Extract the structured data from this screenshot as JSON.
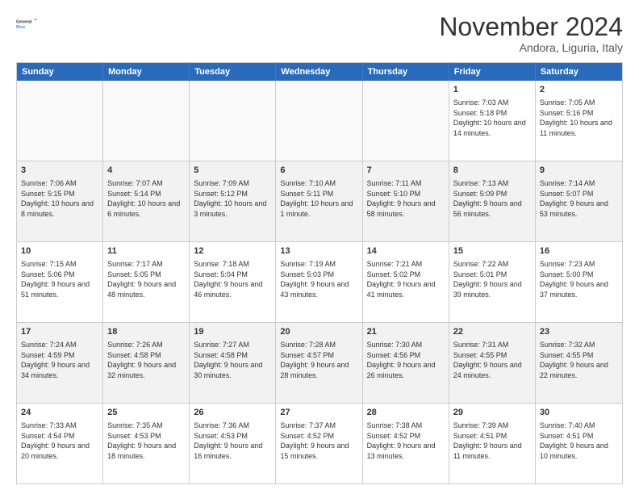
{
  "header": {
    "logo": {
      "line1": "General",
      "line2": "Blue"
    },
    "title": "November 2024",
    "location": "Andora, Liguria, Italy"
  },
  "days_of_week": [
    "Sunday",
    "Monday",
    "Tuesday",
    "Wednesday",
    "Thursday",
    "Friday",
    "Saturday"
  ],
  "weeks": [
    [
      {
        "day": "",
        "info": "",
        "empty": true
      },
      {
        "day": "",
        "info": "",
        "empty": true
      },
      {
        "day": "",
        "info": "",
        "empty": true
      },
      {
        "day": "",
        "info": "",
        "empty": true
      },
      {
        "day": "",
        "info": "",
        "empty": true
      },
      {
        "day": "1",
        "info": "Sunrise: 7:03 AM\nSunset: 5:18 PM\nDaylight: 10 hours and 14 minutes.",
        "empty": false
      },
      {
        "day": "2",
        "info": "Sunrise: 7:05 AM\nSunset: 5:16 PM\nDaylight: 10 hours and 11 minutes.",
        "empty": false
      }
    ],
    [
      {
        "day": "3",
        "info": "Sunrise: 7:06 AM\nSunset: 5:15 PM\nDaylight: 10 hours and 8 minutes.",
        "empty": false
      },
      {
        "day": "4",
        "info": "Sunrise: 7:07 AM\nSunset: 5:14 PM\nDaylight: 10 hours and 6 minutes.",
        "empty": false
      },
      {
        "day": "5",
        "info": "Sunrise: 7:09 AM\nSunset: 5:12 PM\nDaylight: 10 hours and 3 minutes.",
        "empty": false
      },
      {
        "day": "6",
        "info": "Sunrise: 7:10 AM\nSunset: 5:11 PM\nDaylight: 10 hours and 1 minute.",
        "empty": false
      },
      {
        "day": "7",
        "info": "Sunrise: 7:11 AM\nSunset: 5:10 PM\nDaylight: 9 hours and 58 minutes.",
        "empty": false
      },
      {
        "day": "8",
        "info": "Sunrise: 7:13 AM\nSunset: 5:09 PM\nDaylight: 9 hours and 56 minutes.",
        "empty": false
      },
      {
        "day": "9",
        "info": "Sunrise: 7:14 AM\nSunset: 5:07 PM\nDaylight: 9 hours and 53 minutes.",
        "empty": false
      }
    ],
    [
      {
        "day": "10",
        "info": "Sunrise: 7:15 AM\nSunset: 5:06 PM\nDaylight: 9 hours and 51 minutes.",
        "empty": false
      },
      {
        "day": "11",
        "info": "Sunrise: 7:17 AM\nSunset: 5:05 PM\nDaylight: 9 hours and 48 minutes.",
        "empty": false
      },
      {
        "day": "12",
        "info": "Sunrise: 7:18 AM\nSunset: 5:04 PM\nDaylight: 9 hours and 46 minutes.",
        "empty": false
      },
      {
        "day": "13",
        "info": "Sunrise: 7:19 AM\nSunset: 5:03 PM\nDaylight: 9 hours and 43 minutes.",
        "empty": false
      },
      {
        "day": "14",
        "info": "Sunrise: 7:21 AM\nSunset: 5:02 PM\nDaylight: 9 hours and 41 minutes.",
        "empty": false
      },
      {
        "day": "15",
        "info": "Sunrise: 7:22 AM\nSunset: 5:01 PM\nDaylight: 9 hours and 39 minutes.",
        "empty": false
      },
      {
        "day": "16",
        "info": "Sunrise: 7:23 AM\nSunset: 5:00 PM\nDaylight: 9 hours and 37 minutes.",
        "empty": false
      }
    ],
    [
      {
        "day": "17",
        "info": "Sunrise: 7:24 AM\nSunset: 4:59 PM\nDaylight: 9 hours and 34 minutes.",
        "empty": false
      },
      {
        "day": "18",
        "info": "Sunrise: 7:26 AM\nSunset: 4:58 PM\nDaylight: 9 hours and 32 minutes.",
        "empty": false
      },
      {
        "day": "19",
        "info": "Sunrise: 7:27 AM\nSunset: 4:58 PM\nDaylight: 9 hours and 30 minutes.",
        "empty": false
      },
      {
        "day": "20",
        "info": "Sunrise: 7:28 AM\nSunset: 4:57 PM\nDaylight: 9 hours and 28 minutes.",
        "empty": false
      },
      {
        "day": "21",
        "info": "Sunrise: 7:30 AM\nSunset: 4:56 PM\nDaylight: 9 hours and 26 minutes.",
        "empty": false
      },
      {
        "day": "22",
        "info": "Sunrise: 7:31 AM\nSunset: 4:55 PM\nDaylight: 9 hours and 24 minutes.",
        "empty": false
      },
      {
        "day": "23",
        "info": "Sunrise: 7:32 AM\nSunset: 4:55 PM\nDaylight: 9 hours and 22 minutes.",
        "empty": false
      }
    ],
    [
      {
        "day": "24",
        "info": "Sunrise: 7:33 AM\nSunset: 4:54 PM\nDaylight: 9 hours and 20 minutes.",
        "empty": false
      },
      {
        "day": "25",
        "info": "Sunrise: 7:35 AM\nSunset: 4:53 PM\nDaylight: 9 hours and 18 minutes.",
        "empty": false
      },
      {
        "day": "26",
        "info": "Sunrise: 7:36 AM\nSunset: 4:53 PM\nDaylight: 9 hours and 16 minutes.",
        "empty": false
      },
      {
        "day": "27",
        "info": "Sunrise: 7:37 AM\nSunset: 4:52 PM\nDaylight: 9 hours and 15 minutes.",
        "empty": false
      },
      {
        "day": "28",
        "info": "Sunrise: 7:38 AM\nSunset: 4:52 PM\nDaylight: 9 hours and 13 minutes.",
        "empty": false
      },
      {
        "day": "29",
        "info": "Sunrise: 7:39 AM\nSunset: 4:51 PM\nDaylight: 9 hours and 11 minutes.",
        "empty": false
      },
      {
        "day": "30",
        "info": "Sunrise: 7:40 AM\nSunset: 4:51 PM\nDaylight: 9 hours and 10 minutes.",
        "empty": false
      }
    ]
  ]
}
